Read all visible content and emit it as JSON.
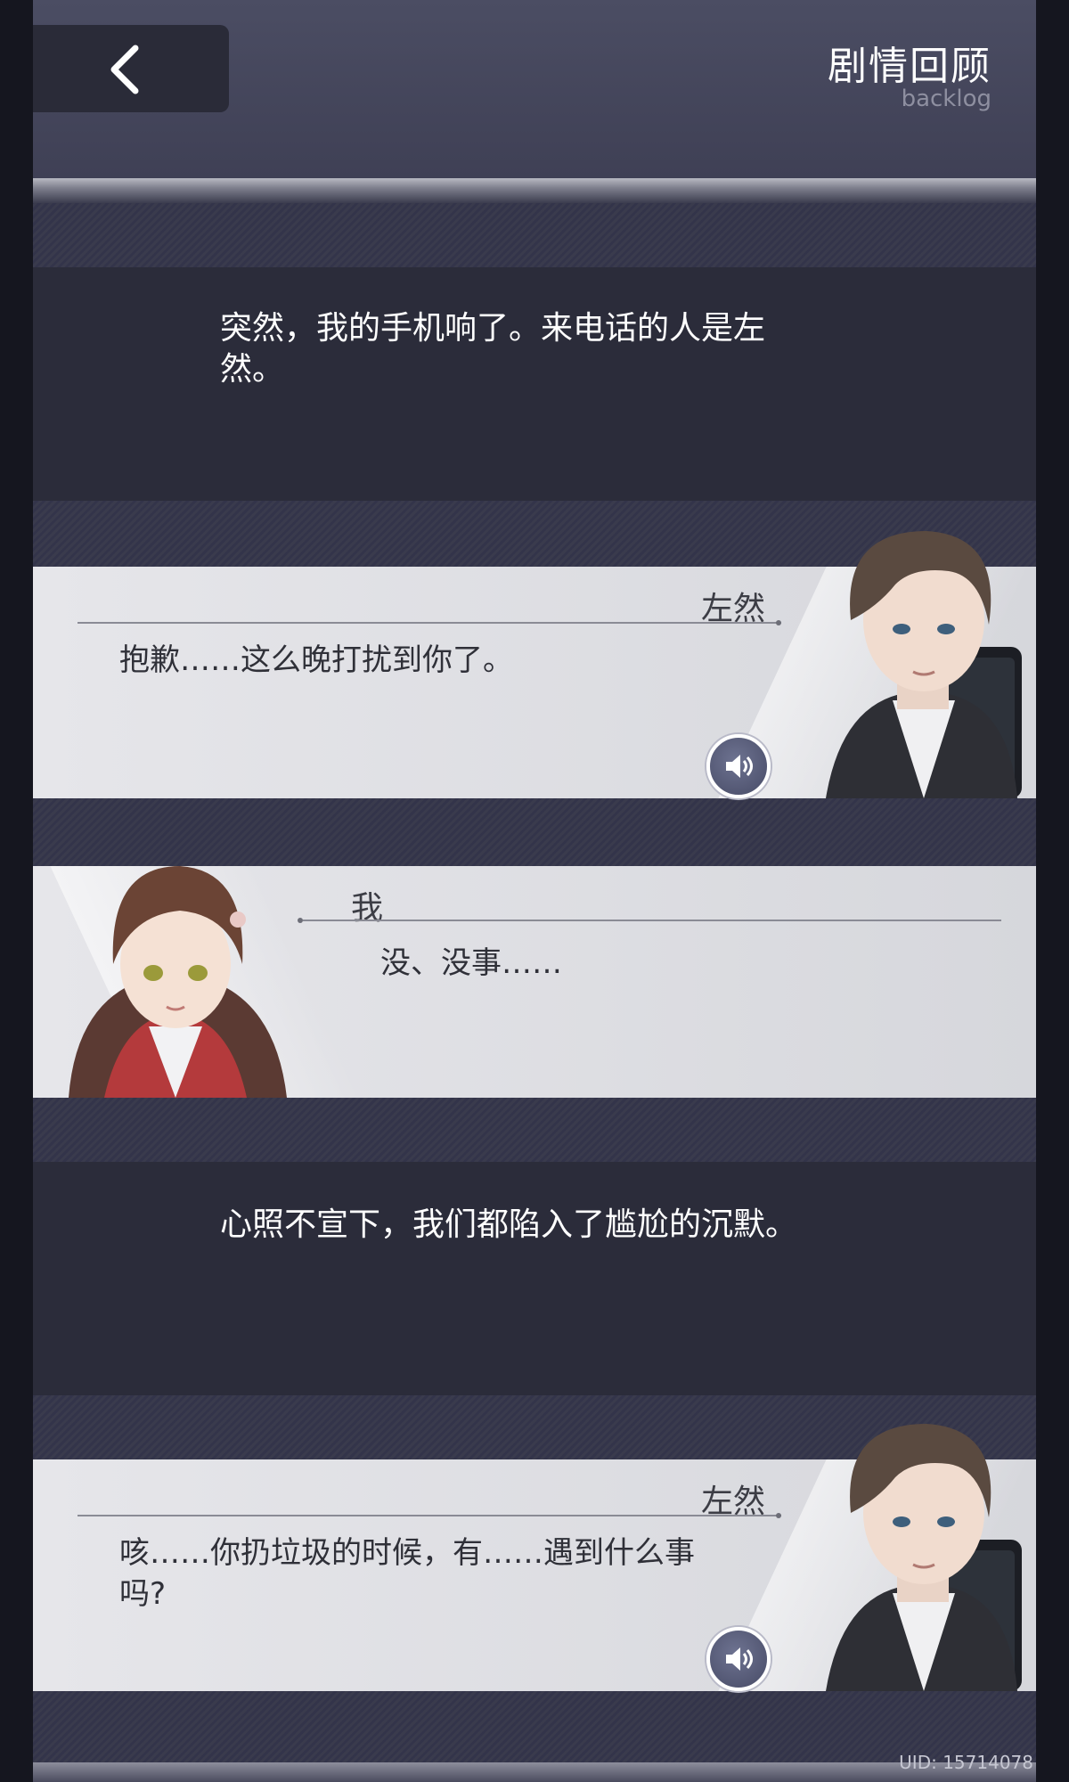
{
  "header": {
    "title": "剧情回顾",
    "subtitle": "backlog",
    "back_icon": "chevron-left-icon"
  },
  "entries": [
    {
      "type": "narration",
      "text": "突然，我的手机响了。来电话的人是左然。"
    },
    {
      "type": "dialogue",
      "speaker": "左然",
      "text": "抱歉……这么晚打扰到你了。",
      "voice_icon": "speaker-icon"
    },
    {
      "type": "dialogue",
      "speaker": "我",
      "text": "没、没事……"
    },
    {
      "type": "narration",
      "text": "心照不宣下，我们都陷入了尴尬的沉默。"
    },
    {
      "type": "dialogue",
      "speaker": "左然",
      "text": "咳……你扔垃圾的时候，有……遇到什么事吗?",
      "voice_icon": "speaker-icon"
    }
  ],
  "footer": {
    "uid": "UID: 15714078"
  },
  "colors": {
    "accent": "#474b66",
    "card": "#e2e2e7",
    "narration_bg": "#2b2c3a"
  }
}
